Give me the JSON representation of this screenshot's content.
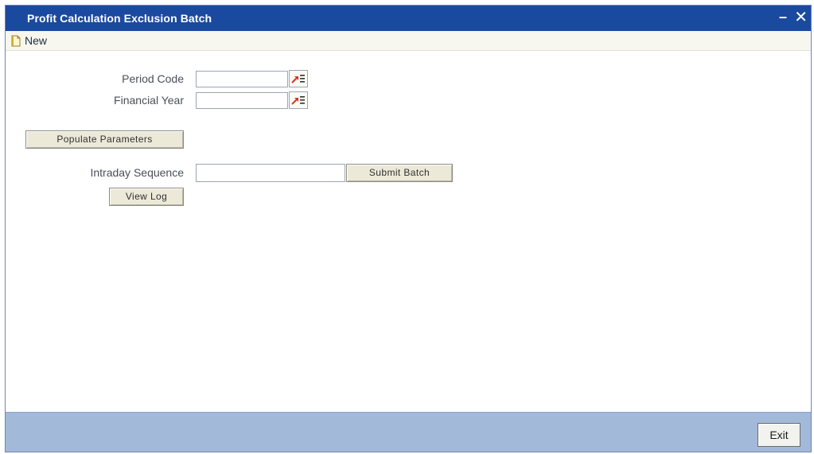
{
  "window": {
    "title": "Profit Calculation Exclusion Batch",
    "minimize_glyph": "–",
    "close_glyph": "✕"
  },
  "toolbar": {
    "new_label": "New",
    "new_icon": "new-document-icon"
  },
  "form": {
    "period_code": {
      "label": "Period Code",
      "value": ""
    },
    "financial_year": {
      "label": "Financial Year",
      "value": ""
    },
    "populate_button": "Populate Parameters",
    "intraday_sequence": {
      "label": "Intraday Sequence",
      "value": ""
    },
    "submit_button": "Submit Batch",
    "view_log_button": "View Log"
  },
  "footer": {
    "exit_button": "Exit"
  },
  "colors": {
    "titlebar": "#1a4a9f",
    "footer": "#a3b9d9",
    "lov_arrow": "#e0321e"
  }
}
